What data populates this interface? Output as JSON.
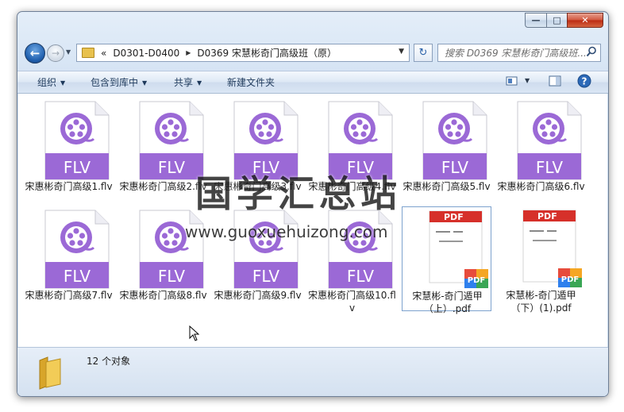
{
  "window": {
    "caption_buttons": [
      "minimize",
      "maximize",
      "close"
    ]
  },
  "nav": {
    "back_icon": "back-arrow-icon",
    "forward_icon": "forward-arrow-icon",
    "breadcrumb_prefix": "«",
    "breadcrumb": [
      "D0301-D0400",
      "D0369 宋慧彬奇门高级班（原）"
    ],
    "search_placeholder": "搜索 D0369 宋慧彬奇门高级班..."
  },
  "toolbar": {
    "organize": "组织",
    "include_in_library": "包含到库中",
    "share": "共享",
    "new_folder": "新建文件夹"
  },
  "files": [
    {
      "name": "宋惠彬奇门高级1.flv",
      "type": "flv"
    },
    {
      "name": "宋惠彬奇门高级2.flv",
      "type": "flv"
    },
    {
      "name": "宋惠彬奇门高级3.flv",
      "type": "flv"
    },
    {
      "name": "宋惠彬奇门高级4.flv",
      "type": "flv"
    },
    {
      "name": "宋惠彬奇门高级5.flv",
      "type": "flv"
    },
    {
      "name": "宋惠彬奇门高级6.flv",
      "type": "flv"
    },
    {
      "name": "宋惠彬奇门高级7.flv",
      "type": "flv"
    },
    {
      "name": "宋惠彬奇门高级8.flv",
      "type": "flv"
    },
    {
      "name": "宋惠彬奇门高级9.flv",
      "type": "flv"
    },
    {
      "name": "宋惠彬奇门高级10.flv",
      "type": "flv"
    },
    {
      "name": "宋慧彬-奇门遁甲（上）.pdf",
      "type": "pdf",
      "selected": true
    },
    {
      "name": "宋慧彬-奇门遁甲（下）(1).pdf",
      "type": "pdf"
    }
  ],
  "icon_labels": {
    "flv": "FLV",
    "pdf_header": "PDF",
    "pdf_badge": "PDF"
  },
  "watermark": {
    "chinese": "国学汇总站",
    "url": "www.guoxuehuizong.com"
  },
  "status": {
    "count": "12 个对象"
  },
  "colors": {
    "flv_purple": "#9b69d6",
    "pdf_red": "#d6302a",
    "close_red": "#c7361b",
    "chrome_blue": "#d3e2f3"
  }
}
